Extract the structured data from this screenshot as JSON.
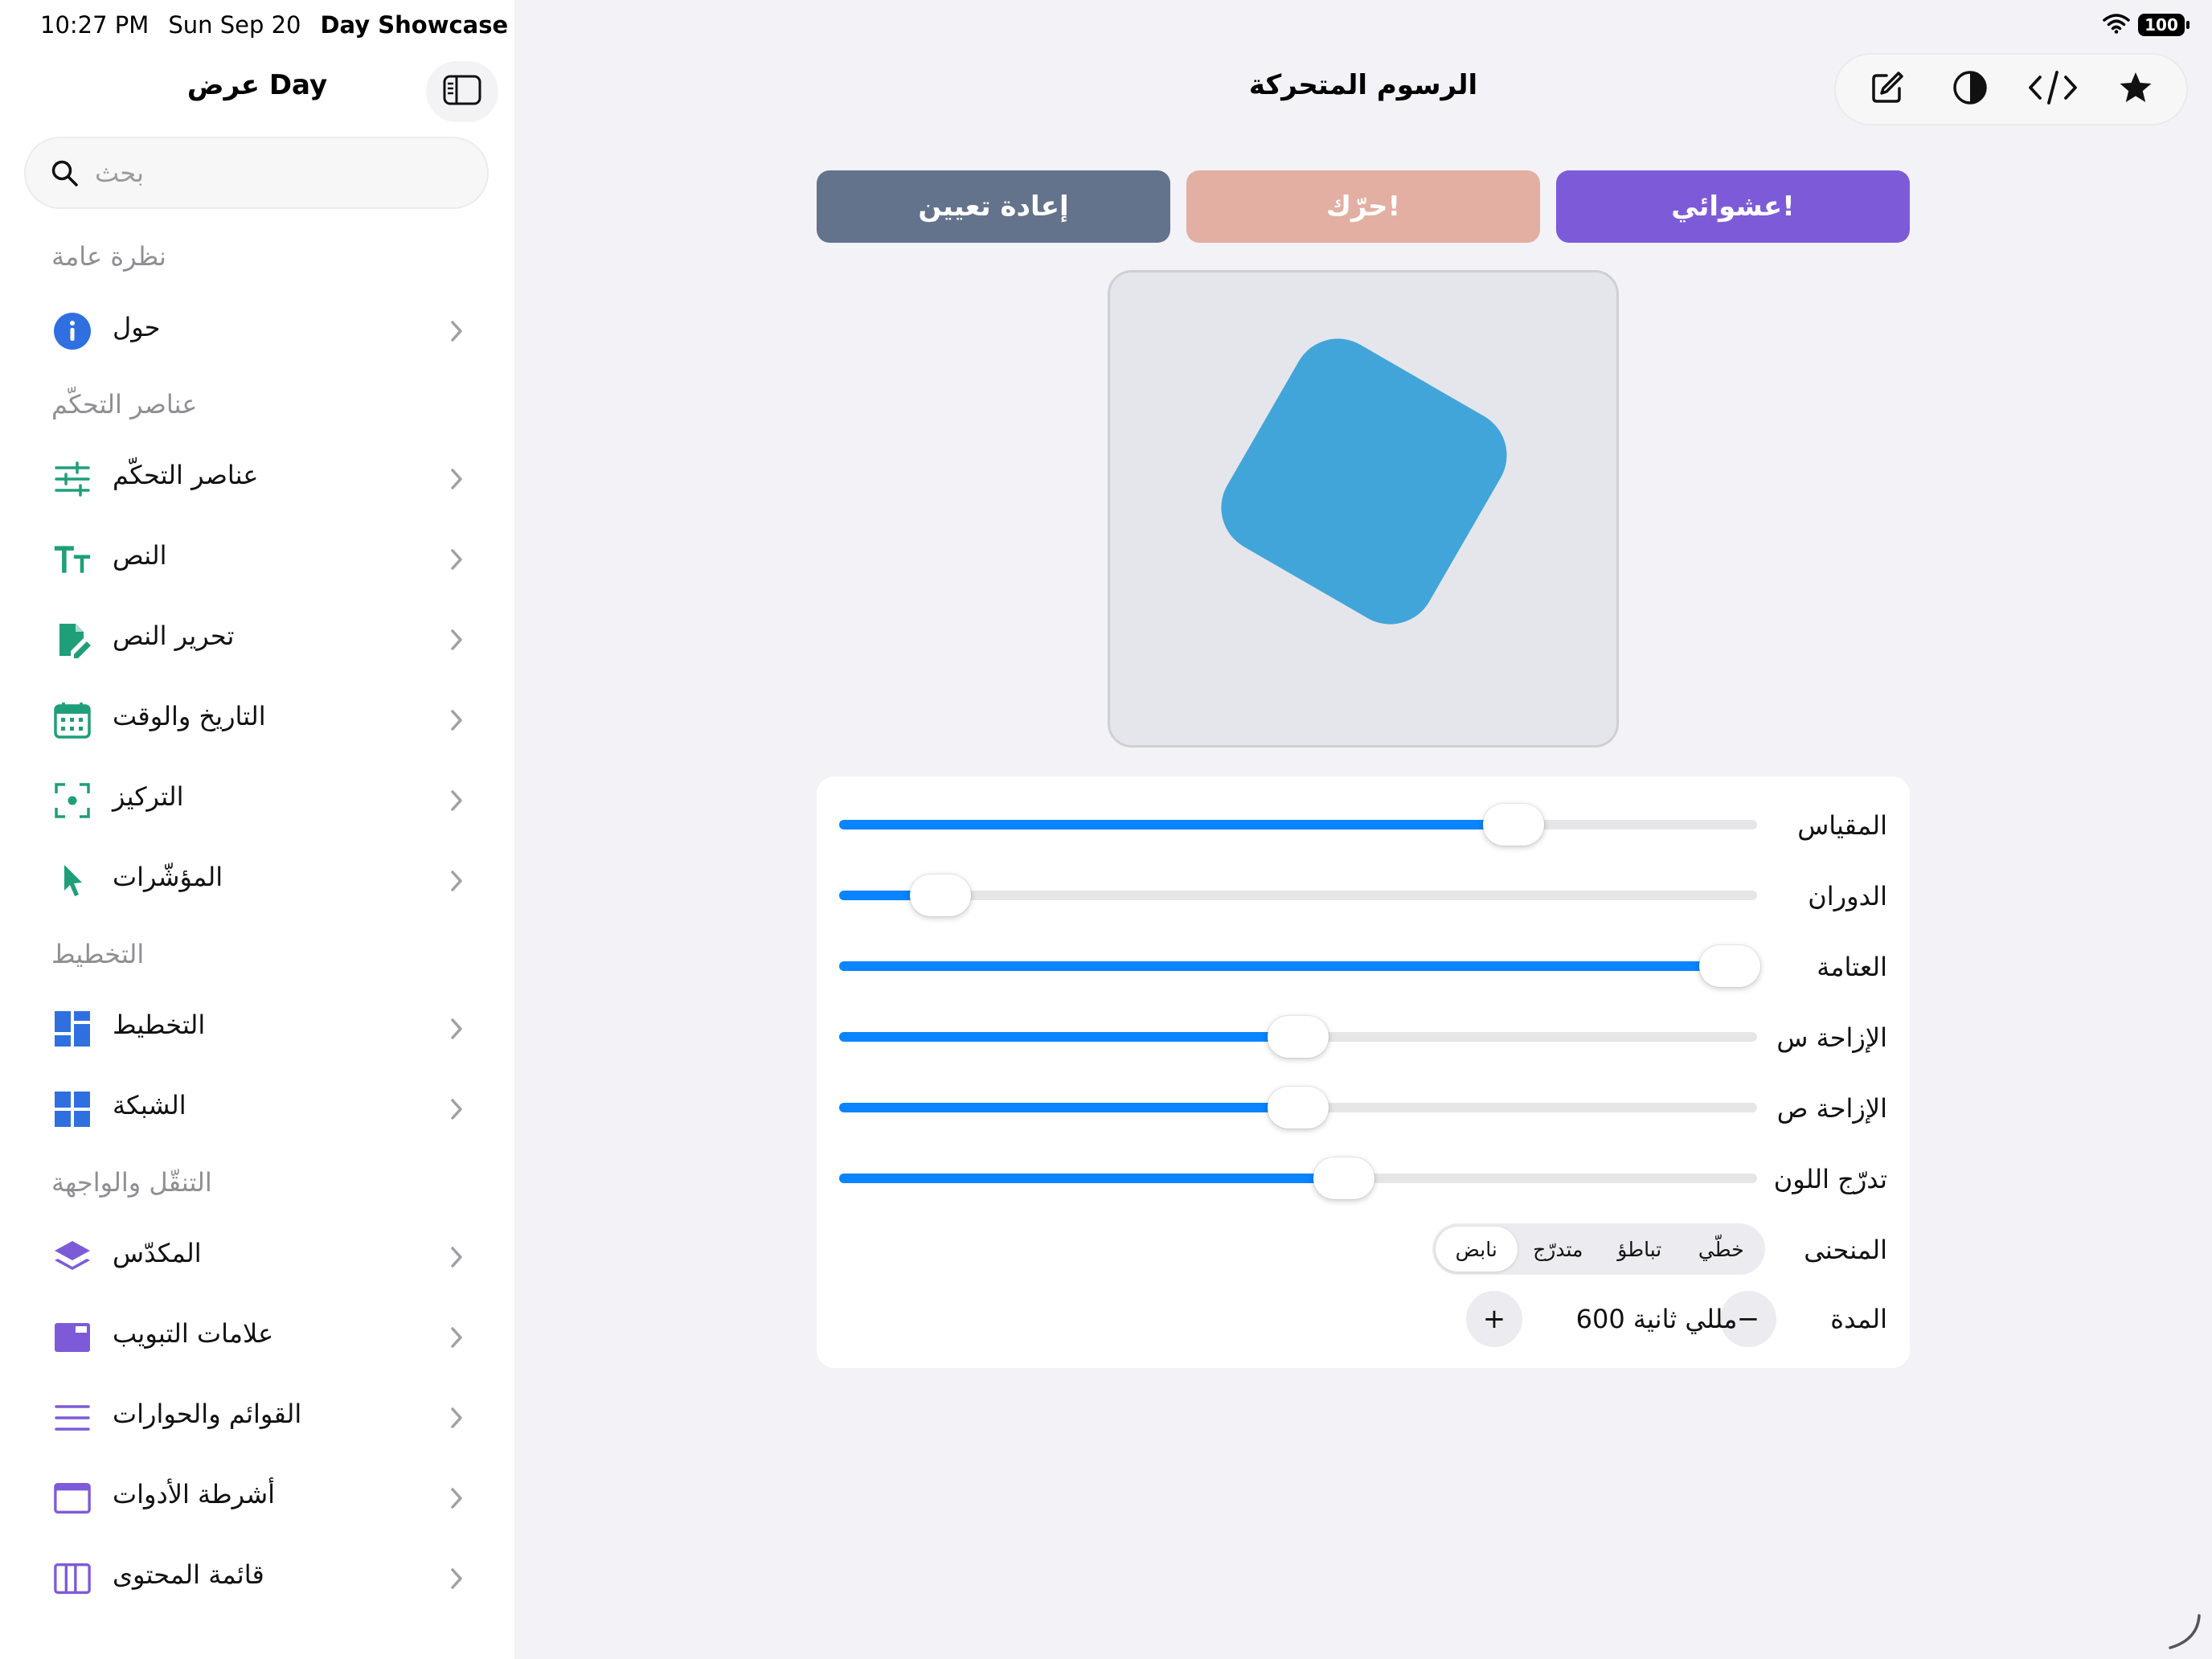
{
  "status_bar": {
    "time": "10:27 PM",
    "date": "Sun Sep 20",
    "app": "Day Showcase",
    "battery": "100"
  },
  "sidebar": {
    "title": "عرض Day",
    "search_placeholder": "بحث",
    "sections": [
      {
        "header": "نظرة عامة",
        "items": [
          {
            "label": "حول",
            "icon": "info-icon",
            "color": "#2f6fe0"
          }
        ]
      },
      {
        "header": "عناصر التحكّم",
        "items": [
          {
            "label": "عناصر التحكّم",
            "icon": "sliders-icon",
            "color": "#1f9e7a"
          },
          {
            "label": "النص",
            "icon": "text-size-icon",
            "color": "#1f9e7a"
          },
          {
            "label": "تحرير النص",
            "icon": "edit-document-icon",
            "color": "#1f9e7a"
          },
          {
            "label": "التاريخ والوقت",
            "icon": "calendar-icon",
            "color": "#1f9e7a"
          },
          {
            "label": "التركيز",
            "icon": "focus-icon",
            "color": "#1f9e7a"
          },
          {
            "label": "المؤشّرات",
            "icon": "pointer-icon",
            "color": "#1f9e7a"
          }
        ]
      },
      {
        "header": "التخطيط",
        "items": [
          {
            "label": "التخطيط",
            "icon": "layout-icon",
            "color": "#2f6fe0"
          },
          {
            "label": "الشبكة",
            "icon": "grid-icon",
            "color": "#2f6fe0"
          }
        ]
      },
      {
        "header": "التنقّل والواجهة",
        "items": [
          {
            "label": "المكدّس",
            "icon": "stack-icon",
            "color": "#7d5bd8"
          },
          {
            "label": "علامات التبويب",
            "icon": "tabs-icon",
            "color": "#7d5bd8"
          },
          {
            "label": "القوائم والحوارات",
            "icon": "menu-lines-icon",
            "color": "#7d5bd8"
          },
          {
            "label": "أشرطة الأدوات",
            "icon": "toolbar-icon",
            "color": "#7d5bd8"
          },
          {
            "label": "قائمة المحتوى",
            "icon": "sidebar-panel-icon",
            "color": "#7d5bd8"
          }
        ]
      }
    ]
  },
  "main": {
    "title": "الرسوم المتحركة",
    "toolbar_icons": [
      "compose-icon",
      "contrast-icon",
      "code-icon",
      "star-icon"
    ],
    "buttons": {
      "random": "عشوائي!",
      "move": "حرّك!",
      "reset": "إعادة تعيين"
    },
    "button_colors": {
      "random": "#7d5bd8",
      "move": "#e2afa2",
      "reset": "#63738b"
    },
    "shape_color": "#42a5d9",
    "accent_color": "#0a84ff",
    "sliders": [
      {
        "label": "المقياس",
        "value": 0.735
      },
      {
        "label": "الدوران",
        "value": 0.11
      },
      {
        "label": "العتامة",
        "value": 0.97
      },
      {
        "label": "الإزاحة س",
        "value": 0.5
      },
      {
        "label": "الإزاحة ص",
        "value": 0.5
      },
      {
        "label": "تدرّج اللون",
        "value": 0.55
      }
    ],
    "curve": {
      "label": "المنحنى",
      "options": [
        "خطّي",
        "تباطؤ",
        "متدرّج",
        "نابض"
      ],
      "selected": "نابض"
    },
    "duration": {
      "label": "المدة",
      "value": "600 مللي ثانية",
      "minus": "−",
      "plus": "+"
    }
  }
}
